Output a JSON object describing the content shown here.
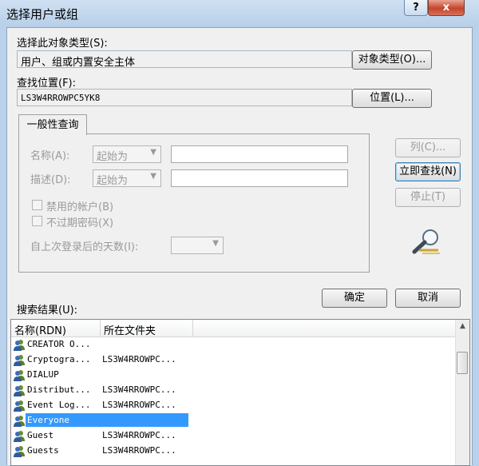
{
  "window": {
    "title": "选择用户或组",
    "help_label": "?",
    "close_label": "x"
  },
  "object_types": {
    "label": "选择此对象类型(S):",
    "value": "用户、组或内置安全主体",
    "button": "对象类型(O)..."
  },
  "location": {
    "label": "查找位置(F):",
    "value": "LS3W4RROWPC5YK8",
    "button": "位置(L)..."
  },
  "query_tab": {
    "label": "一般性查询"
  },
  "query": {
    "name_label": "名称(A):",
    "name_mode": "起始为",
    "desc_label": "描述(D):",
    "desc_mode": "起始为",
    "disabled_accounts": "禁用的帐户(B)",
    "non_expiring_pw": "不过期密码(X)",
    "days_since_logon": "自上次登录后的天数(I):"
  },
  "side_buttons": {
    "columns": "列(C)...",
    "find_now": "立即查找(N)",
    "stop": "停止(T)"
  },
  "dialog_buttons": {
    "ok": "确定",
    "cancel": "取消"
  },
  "results": {
    "label": "搜索结果(U):",
    "columns": [
      "名称(RDN)",
      "所在文件夹"
    ],
    "rows": [
      {
        "name": "CREATOR O...",
        "folder": ""
      },
      {
        "name": "Cryptogra...",
        "folder": "LS3W4RROWPC..."
      },
      {
        "name": "DIALUP",
        "folder": ""
      },
      {
        "name": "Distribut...",
        "folder": "LS3W4RROWPC..."
      },
      {
        "name": "Event Log...",
        "folder": "LS3W4RROWPC..."
      },
      {
        "name": "Everyone",
        "folder": "",
        "selected": true
      },
      {
        "name": "Guest",
        "folder": "LS3W4RROWPC..."
      },
      {
        "name": "Guests",
        "folder": "LS3W4RROWPC..."
      }
    ]
  },
  "colors": {
    "selection": "#3399ff",
    "chrome": "#b9d1ea",
    "close": "#c4452c"
  },
  "icons": {
    "row_icon": "user-group-icon",
    "search_decoration": "flashlight-icon"
  }
}
